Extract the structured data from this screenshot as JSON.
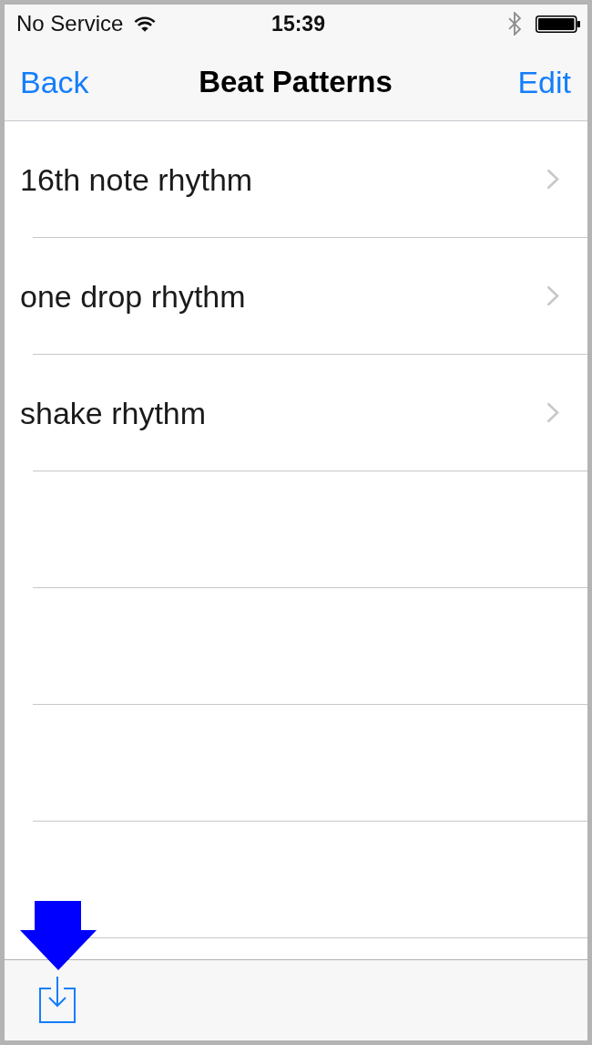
{
  "status_bar": {
    "carrier": "No Service",
    "time": "15:39"
  },
  "nav_bar": {
    "back": "Back",
    "title": "Beat Patterns",
    "edit": "Edit"
  },
  "list": {
    "rows": [
      {
        "title": "16th note rhythm"
      },
      {
        "title": "one drop rhythm"
      },
      {
        "title": "shake rhythm"
      }
    ]
  }
}
